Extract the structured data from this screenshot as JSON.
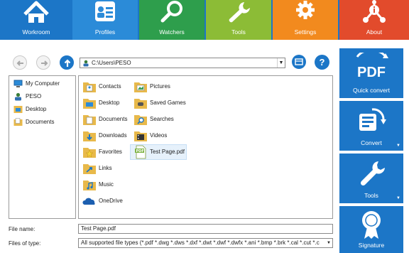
{
  "tabs": [
    {
      "label": "Workroom",
      "icon": "home-icon"
    },
    {
      "label": "Profiles",
      "icon": "profile-card-icon"
    },
    {
      "label": "Watchers",
      "icon": "magnifier-icon"
    },
    {
      "label": "Tools",
      "icon": "wrench-icon"
    },
    {
      "label": "Settings",
      "icon": "gear-icon"
    },
    {
      "label": "About",
      "icon": "info-network-icon"
    }
  ],
  "path": {
    "value": "C:\\Users\\PESO"
  },
  "tree": [
    {
      "label": "My Computer",
      "icon": "computer-icon"
    },
    {
      "label": "PESO",
      "icon": "user-folder-icon"
    },
    {
      "label": "Desktop",
      "icon": "desktop-folder-icon"
    },
    {
      "label": "Documents",
      "icon": "documents-folder-icon"
    }
  ],
  "files_col1": [
    {
      "label": "Contacts",
      "icon": "contacts-folder-icon"
    },
    {
      "label": "Desktop",
      "icon": "desktop-folder-icon"
    },
    {
      "label": "Documents",
      "icon": "documents-folder-icon"
    },
    {
      "label": "Downloads",
      "icon": "downloads-folder-icon"
    },
    {
      "label": "Favorites",
      "icon": "favorites-folder-icon"
    },
    {
      "label": "Links",
      "icon": "links-folder-icon"
    },
    {
      "label": "Music",
      "icon": "music-folder-icon"
    },
    {
      "label": "OneDrive",
      "icon": "onedrive-icon"
    }
  ],
  "files_col2": [
    {
      "label": "Pictures",
      "icon": "pictures-folder-icon"
    },
    {
      "label": "Saved Games",
      "icon": "saved-games-folder-icon"
    },
    {
      "label": "Searches",
      "icon": "searches-folder-icon"
    },
    {
      "label": "Videos",
      "icon": "videos-folder-icon"
    },
    {
      "label": "Test Page.pdf",
      "icon": "pdf-file-icon"
    }
  ],
  "file_name": {
    "label": "File name:",
    "value": "Test Page.pdf"
  },
  "file_type": {
    "label": "Files of type:",
    "value": "All supported file types (*.pdf *.dwg *.dws *.dxf *.dwt *.dwf *.dwfx *.ani *.bmp *.brk *.cal *.cut *.c"
  },
  "actions": [
    {
      "label": "Quick convert",
      "icon": "pdf-icon"
    },
    {
      "label": "Convert",
      "icon": "convert-icon"
    },
    {
      "label": "Tools",
      "icon": "wrench-icon"
    },
    {
      "label": "Signature",
      "icon": "ribbon-badge-icon"
    }
  ],
  "colors": {
    "blue": "#1c76c7",
    "profiles": "#2b8bd8",
    "watchers": "#2e9e4c",
    "tools": "#8cbc36",
    "settings": "#f28a1e",
    "about": "#e24b2c"
  }
}
